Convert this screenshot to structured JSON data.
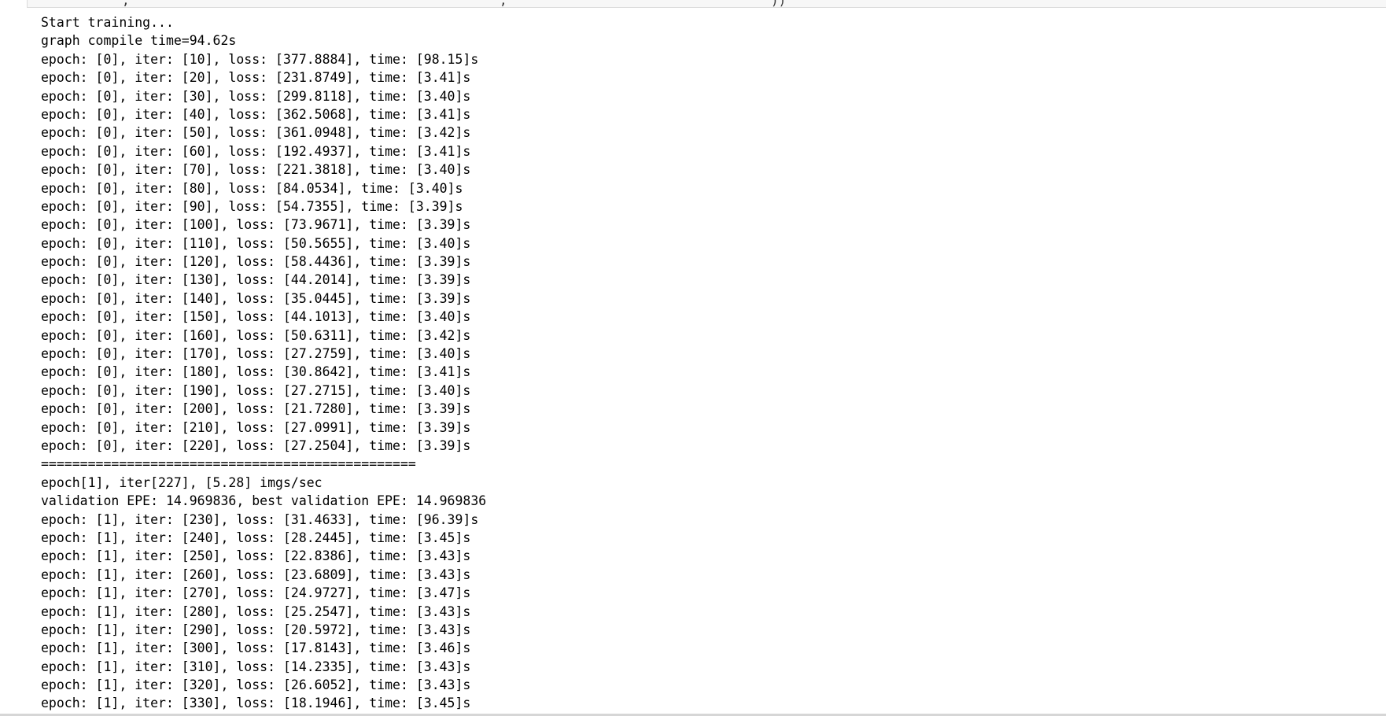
{
  "colors": {
    "text": "#000000",
    "background": "#ffffff",
    "code_fragment": "#333333",
    "code_string": "#ba2121",
    "cell_border": "#dcdcdc"
  },
  "output": {
    "lines": [
      "Start training...",
      "graph compile time=94.62s",
      "epoch: [0], iter: [10], loss: [377.8884], time: [98.15]s",
      "epoch: [0], iter: [20], loss: [231.8749], time: [3.41]s",
      "epoch: [0], iter: [30], loss: [299.8118], time: [3.40]s",
      "epoch: [0], iter: [40], loss: [362.5068], time: [3.41]s",
      "epoch: [0], iter: [50], loss: [361.0948], time: [3.42]s",
      "epoch: [0], iter: [60], loss: [192.4937], time: [3.41]s",
      "epoch: [0], iter: [70], loss: [221.3818], time: [3.40]s",
      "epoch: [0], iter: [80], loss: [84.0534], time: [3.40]s",
      "epoch: [0], iter: [90], loss: [54.7355], time: [3.39]s",
      "epoch: [0], iter: [100], loss: [73.9671], time: [3.39]s",
      "epoch: [0], iter: [110], loss: [50.5655], time: [3.40]s",
      "epoch: [0], iter: [120], loss: [58.4436], time: [3.39]s",
      "epoch: [0], iter: [130], loss: [44.2014], time: [3.39]s",
      "epoch: [0], iter: [140], loss: [35.0445], time: [3.39]s",
      "epoch: [0], iter: [150], loss: [44.1013], time: [3.40]s",
      "epoch: [0], iter: [160], loss: [50.6311], time: [3.42]s",
      "epoch: [0], iter: [170], loss: [27.2759], time: [3.40]s",
      "epoch: [0], iter: [180], loss: [30.8642], time: [3.41]s",
      "epoch: [0], iter: [190], loss: [27.2715], time: [3.40]s",
      "epoch: [0], iter: [200], loss: [21.7280], time: [3.39]s",
      "epoch: [0], iter: [210], loss: [27.0991], time: [3.39]s",
      "epoch: [0], iter: [220], loss: [27.2504], time: [3.39]s",
      "================================================",
      "epoch[1], iter[227], [5.28] imgs/sec",
      "validation EPE: 14.969836, best validation EPE: 14.969836",
      "epoch: [1], iter: [230], loss: [31.4633], time: [96.39]s",
      "epoch: [1], iter: [240], loss: [28.2445], time: [3.45]s",
      "epoch: [1], iter: [250], loss: [22.8386], time: [3.43]s",
      "epoch: [1], iter: [260], loss: [23.6809], time: [3.43]s",
      "epoch: [1], iter: [270], loss: [24.9727], time: [3.47]s",
      "epoch: [1], iter: [280], loss: [25.2547], time: [3.43]s",
      "epoch: [1], iter: [290], loss: [20.5972], time: [3.43]s",
      "epoch: [1], iter: [300], loss: [17.8143], time: [3.46]s",
      "epoch: [1], iter: [310], loss: [14.2335], time: [3.43]s",
      "epoch: [1], iter: [320], loss: [26.6052], time: [3.43]s",
      "epoch: [1], iter: [330], loss: [18.1946], time: [3.45]s"
    ]
  }
}
